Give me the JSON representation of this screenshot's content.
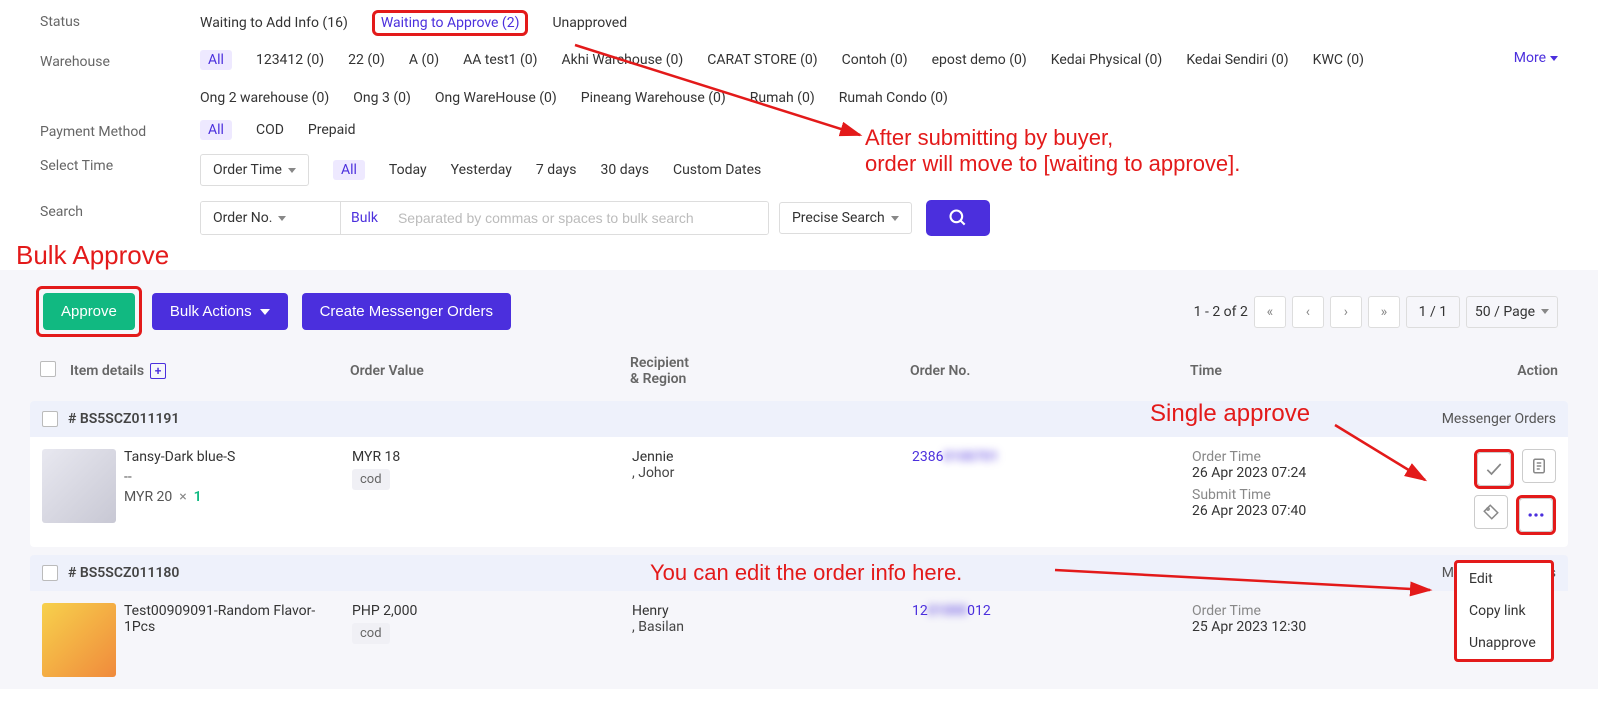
{
  "filters": {
    "status": {
      "label": "Status",
      "waiting_add": "Waiting to Add Info (16)",
      "waiting_approve": "Waiting to Approve (2)",
      "unapproved": "Unapproved"
    },
    "warehouse": {
      "label": "Warehouse",
      "all": "All",
      "more": "More",
      "items": [
        "123412 (0)",
        "22 (0)",
        "A (0)",
        "AA test1 (0)",
        "Akhi Warehouse (0)",
        "CARAT STORE (0)",
        "Contoh (0)",
        "epost demo (0)",
        "Kedai Physical (0)",
        "Kedai Sendiri (0)",
        "KWC (0)",
        "Ong 2 warehouse (0)",
        "Ong 3 (0)",
        "Ong WareHouse (0)",
        "Pineang Warehouse (0)",
        "Rumah (0)",
        "Rumah Condo (0)"
      ]
    },
    "payment": {
      "label": "Payment Method",
      "all": "All",
      "cod": "COD",
      "prepaid": "Prepaid"
    },
    "time": {
      "label": "Select Time",
      "order_time": "Order Time",
      "all": "All",
      "today": "Today",
      "yesterday": "Yesterday",
      "d7": "7 days",
      "d30": "30 days",
      "custom": "Custom Dates"
    },
    "search": {
      "label": "Search",
      "orderno": "Order No.",
      "bulk": "Bulk",
      "placeholder": "Separated by commas or spaces to bulk search",
      "precise": "Precise Search"
    }
  },
  "annotations": {
    "bulk_approve": "Bulk Approve",
    "after_submit": "After submitting by buyer,\norder will move to [waiting to approve].",
    "after_submit_l1": "After submitting by buyer,",
    "after_submit_l2": "order will move to [waiting to approve].",
    "single_approve": "Single approve",
    "edit_info": "You can edit the order info here."
  },
  "toolbar": {
    "approve": "Approve",
    "bulk_actions": "Bulk Actions",
    "create_messenger": "Create Messenger Orders",
    "range": "1 - 2 of 2",
    "page_of": "1 / 1",
    "per_page": "50 / Page"
  },
  "columns": {
    "item": "Item details",
    "value": "Order Value",
    "recipient": "Recipient & Region",
    "recipient_l1": "Recipient",
    "recipient_l2": "& Region",
    "orderno": "Order No.",
    "time": "Time",
    "action": "Action"
  },
  "orders": [
    {
      "id": "# BS5SCZ011191",
      "type": "Messenger Orders",
      "item_name": "Tansy-Dark blue-S",
      "item_sub": "--",
      "price": "MYR 20",
      "qty": "1",
      "value": "MYR 18",
      "pay_badge": "cod",
      "recipient_name": "Jennie",
      "recipient_region": ", Johor",
      "orderno_visible": "2386",
      "orderno_hidden": "0100701",
      "order_time_label": "Order Time",
      "order_time": "26 Apr 2023 07:24",
      "submit_time_label": "Submit Time",
      "submit_time": "26 Apr 2023 07:40"
    },
    {
      "id": "# BS5SCZ011180",
      "type": "Messenger Orders",
      "item_name": "Test00909091-Random Flavor-1Pcs",
      "value": "PHP 2,000",
      "pay_badge": "cod",
      "recipient_name": "Henry",
      "recipient_region": ", Basilan",
      "orderno_visible": "12",
      "orderno_hidden": "01000",
      "orderno_tail": "012",
      "order_time_label": "Order Time",
      "order_time": "25 Apr 2023 12:30"
    }
  ],
  "menu": {
    "edit": "Edit",
    "copy": "Copy link",
    "unapprove": "Unapprove"
  }
}
